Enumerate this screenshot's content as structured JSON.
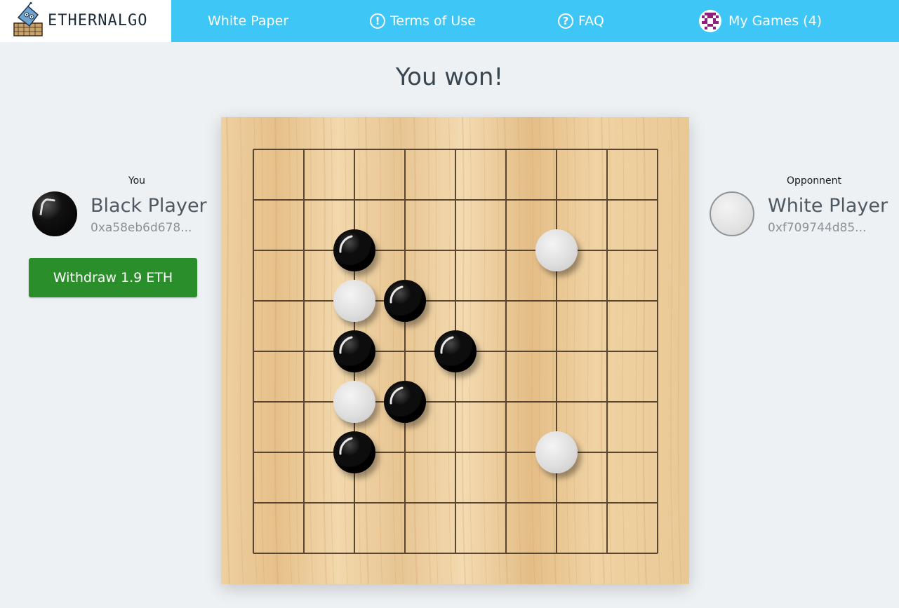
{
  "header": {
    "logo_text": "ETHERNALGO",
    "nav": [
      {
        "label": "White Paper",
        "icon": "none"
      },
      {
        "label": "Terms of Use",
        "icon": "exclamation-circle-icon"
      },
      {
        "label": "FAQ",
        "icon": "question-circle-icon"
      },
      {
        "label": "My Games (4)",
        "icon": "pixel-avatar-icon"
      }
    ]
  },
  "main": {
    "result_title": "You won!",
    "withdraw_label": "Withdraw 1.9 ETH"
  },
  "players": {
    "you": {
      "role": "You",
      "name": "Black Player",
      "address": "0xa58eb6d678..."
    },
    "opponent": {
      "role": "Opponnent",
      "name": "White Player",
      "address": "0xf709744d85..."
    }
  },
  "board": {
    "size": 9,
    "colors": {
      "wood_light": "#f0d3a3",
      "wood_dark": "#e3bd85",
      "grid_line": "#5a4630"
    },
    "stones": [
      {
        "color": "black",
        "col": 2,
        "row": 2
      },
      {
        "color": "white",
        "col": 6,
        "row": 2
      },
      {
        "color": "white",
        "col": 2,
        "row": 3
      },
      {
        "color": "black",
        "col": 3,
        "row": 3
      },
      {
        "color": "black",
        "col": 2,
        "row": 4
      },
      {
        "color": "black",
        "col": 4,
        "row": 4
      },
      {
        "color": "white",
        "col": 2,
        "row": 5
      },
      {
        "color": "black",
        "col": 3,
        "row": 5
      },
      {
        "color": "black",
        "col": 2,
        "row": 6
      },
      {
        "color": "white",
        "col": 6,
        "row": 6
      }
    ]
  }
}
